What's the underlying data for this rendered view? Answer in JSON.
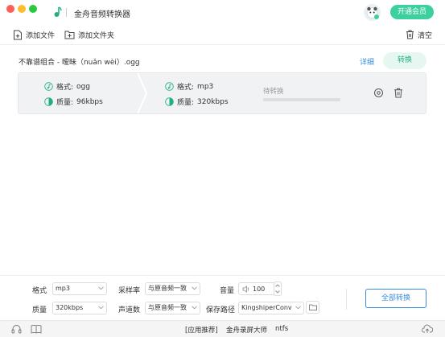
{
  "window": {
    "title": "金舟音频转换器",
    "vip_button": "开通会员"
  },
  "toolbar": {
    "add_file": "添加文件",
    "add_folder": "添加文件夹",
    "clear": "清空"
  },
  "file": {
    "name": "不靠谱组合 - 暧昧（nuǎn wèi）.ogg",
    "detail_link": "详细",
    "convert_button": "转换",
    "source": {
      "format_label": "格式:",
      "format_value": "ogg",
      "quality_label": "质量:",
      "quality_value": "96kbps"
    },
    "target": {
      "format_label": "格式:",
      "format_value": "mp3",
      "quality_label": "质量:",
      "quality_value": "320kbps"
    },
    "status": "待转换",
    "progress_fraction": 0
  },
  "settings": {
    "format_label": "格式",
    "format_value": "mp3",
    "quality_label": "质量",
    "quality_value": "320kbps",
    "samplerate_label": "采样率",
    "samplerate_value": "与原音频一致",
    "channels_label": "声道数",
    "channels_value": "与原音频一致",
    "volume_label": "音量",
    "volume_value": "100",
    "savepath_label": "保存路径",
    "savepath_value": "KingshiperConvert",
    "convert_all_button": "全部转换"
  },
  "footer": {
    "recommend_label": "[应用推荐]",
    "recommend_app": "金舟录屏大师",
    "ntfs": "ntfs"
  },
  "colors": {
    "accent_green": "#3ccfa0",
    "accent_blue": "#3a8dd8"
  }
}
